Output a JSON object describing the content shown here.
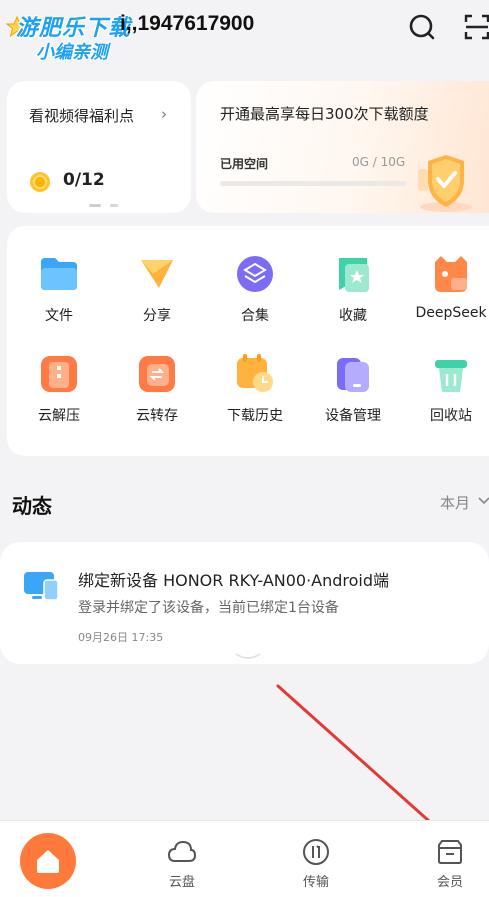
{
  "header": {
    "watermark_line1": "游肥乐下载",
    "watermark_line2": "小编亲测",
    "phone_masked": "i,,1947617900",
    "icons": [
      "search-icon",
      "scan-icon"
    ]
  },
  "benefit_card": {
    "title": "看视频得福利点",
    "chevron": "›",
    "count": "0/12"
  },
  "quota_card": {
    "title": "开通最高享每日300次下载额度",
    "used_label": "已用空间",
    "used_value": "0G / 10G",
    "used_fraction": 0
  },
  "grid": {
    "items": [
      {
        "label": "文件",
        "icon": "folder-icon"
      },
      {
        "label": "分享",
        "icon": "share-icon"
      },
      {
        "label": "合集",
        "icon": "collection-icon"
      },
      {
        "label": "收藏",
        "icon": "favorite-icon"
      },
      {
        "label": "DeepSeek",
        "icon": "deepseek-icon"
      },
      {
        "label": "云解压",
        "icon": "unzip-icon"
      },
      {
        "label": "云转存",
        "icon": "cloud-save-icon"
      },
      {
        "label": "下载历史",
        "icon": "download-history-icon"
      },
      {
        "label": "设备管理",
        "icon": "device-manage-icon"
      },
      {
        "label": "回收站",
        "icon": "recycle-bin-icon"
      }
    ]
  },
  "activity": {
    "section_title": "动态",
    "filter": "本月",
    "items": [
      {
        "title": "绑定新设备  HONOR  RKY-AN00·Android端",
        "desc": "登录并绑定了该设备，当前已绑定1台设备",
        "time": "09月26日 17:35"
      }
    ]
  },
  "bottom_nav": {
    "items": [
      {
        "label": "",
        "icon": "home-icon"
      },
      {
        "label": "云盘",
        "icon": "cloud-icon"
      },
      {
        "label": "传输",
        "icon": "transfer-icon"
      },
      {
        "label": "会员",
        "icon": "member-icon"
      }
    ]
  },
  "colors": {
    "accent": "#ff7a3a",
    "arrow": "#e53935"
  }
}
